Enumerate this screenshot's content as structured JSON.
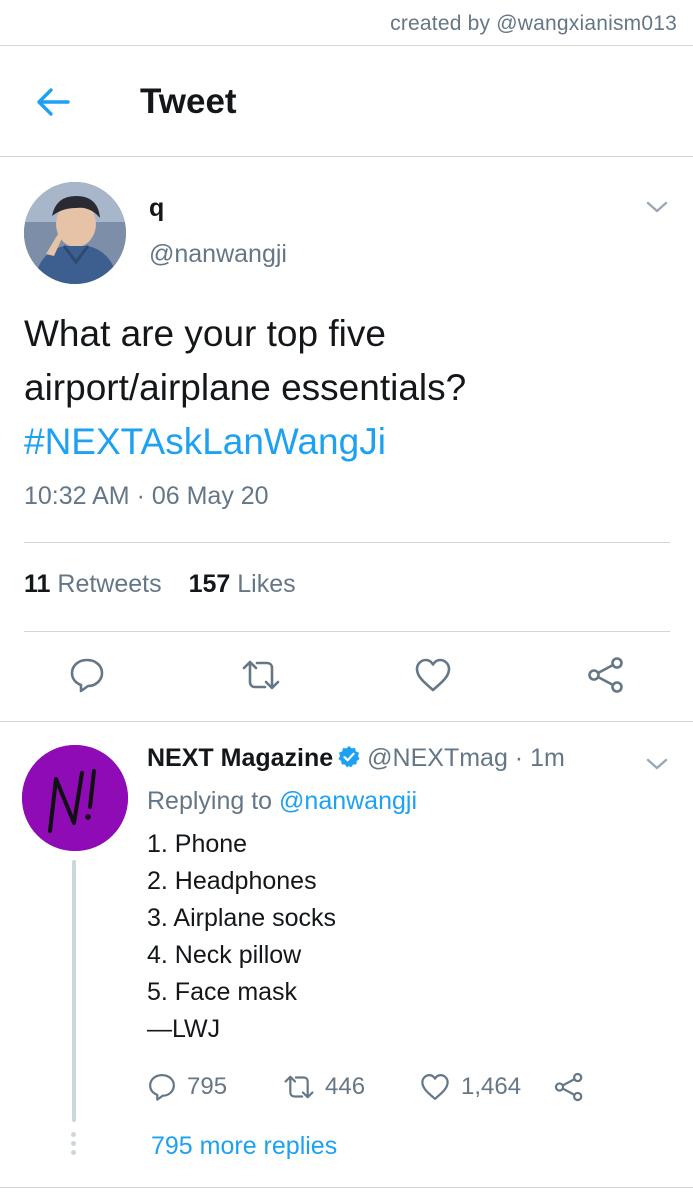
{
  "credit": "created by @wangxianism013",
  "header": {
    "title": "Tweet"
  },
  "tweet": {
    "author_name": "q",
    "author_handle": "@nanwangji",
    "text_line1": "What are your top five",
    "text_line2": "airport/airplane essentials?",
    "hashtag": "#NEXTAskLanWangJi",
    "timestamp": "10:32 AM · 06 May 20",
    "retweets_count": "11",
    "retweets_label": "Retweets",
    "likes_count": "157",
    "likes_label": "Likes"
  },
  "reply": {
    "author_name": "NEXT Magazine",
    "author_handle": "@NEXTmag",
    "time": "· 1m",
    "replying_prefix": "Replying to",
    "replying_to": "@nanwangji",
    "lines": [
      "1. Phone",
      "2. Headphones",
      "3. Airplane socks",
      "4. Neck pillow",
      "5. Face mask",
      "—LWJ"
    ],
    "reply_count": "795",
    "retweet_count": "446",
    "like_count": "1,464",
    "more_replies": "795 more replies"
  },
  "icons": {
    "back": "arrow-left-icon",
    "caret": "chevron-down-icon",
    "reply": "speech-bubble-icon",
    "retweet": "retweet-arrows-icon",
    "like": "heart-icon",
    "share": "share-icon",
    "verified": "verified-badge-icon"
  },
  "colors": {
    "accent": "#1da1f2",
    "secondary_text": "#657786",
    "primary_text": "#14171a",
    "divider": "#d6d6d6",
    "reply_avatar": "#8e0bb5"
  }
}
